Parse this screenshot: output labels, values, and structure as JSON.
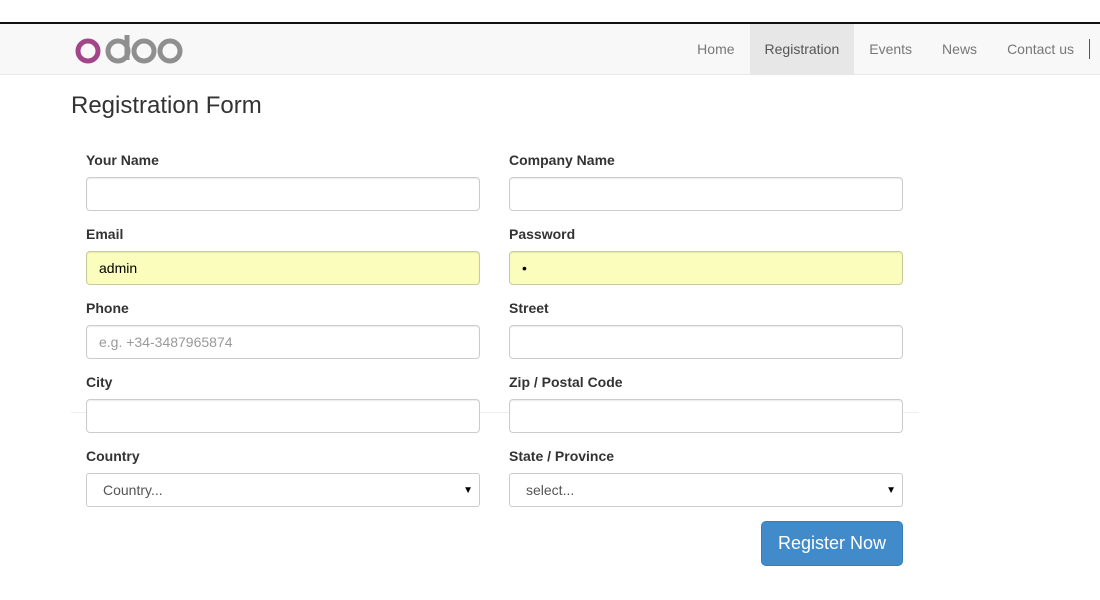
{
  "brand": {
    "logo_text": "odoo",
    "accent_color": "#a24689",
    "logo_gray": "#8f8f8f"
  },
  "nav": {
    "items": [
      {
        "label": "Home",
        "active": false
      },
      {
        "label": "Registration",
        "active": true
      },
      {
        "label": "Events",
        "active": false
      },
      {
        "label": "News",
        "active": false
      },
      {
        "label": "Contact us",
        "active": false
      }
    ]
  },
  "page": {
    "title": "Registration Form"
  },
  "form": {
    "your_name": {
      "label": "Your Name",
      "value": "",
      "placeholder": ""
    },
    "company_name": {
      "label": "Company Name",
      "value": "",
      "placeholder": ""
    },
    "email": {
      "label": "Email",
      "value": "admin",
      "placeholder": ""
    },
    "password": {
      "label": "Password",
      "value": "•",
      "placeholder": ""
    },
    "phone": {
      "label": "Phone",
      "value": "",
      "placeholder": "e.g. +34-3487965874"
    },
    "street": {
      "label": "Street",
      "value": "",
      "placeholder": ""
    },
    "city": {
      "label": "City",
      "value": "",
      "placeholder": ""
    },
    "zip": {
      "label": "Zip / Postal Code",
      "value": "",
      "placeholder": ""
    },
    "country": {
      "label": "Country",
      "selected": "Country..."
    },
    "state": {
      "label": "State / Province",
      "selected": "select..."
    },
    "submit_label": "Register Now",
    "submit_color": "#428bca",
    "autofill_color": "#fbfdbc"
  }
}
